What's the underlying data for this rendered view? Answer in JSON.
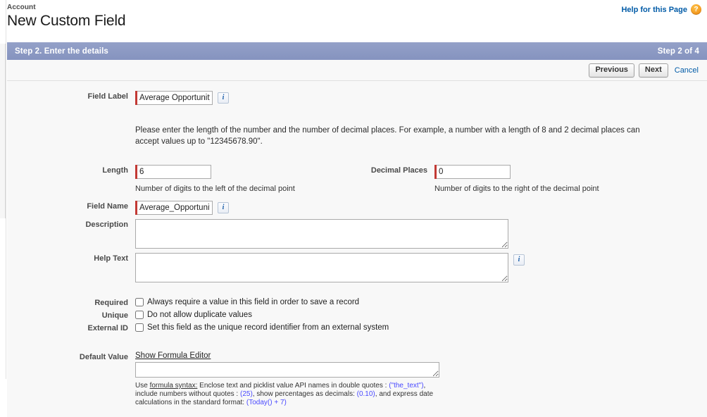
{
  "header": {
    "breadcrumb": "Account",
    "title": "New Custom Field",
    "help_link": "Help for this Page",
    "help_icon": "question-mark-icon"
  },
  "wizard": {
    "step_title": "Step 2. Enter the details",
    "step_count": "Step 2 of 4",
    "buttons": {
      "previous": "Previous",
      "next": "Next",
      "cancel": "Cancel"
    }
  },
  "form": {
    "field_label": {
      "label": "Field Label",
      "value": "Average Opportunity A",
      "info": "i",
      "required": true
    },
    "instruction": "Please enter the length of the number and the number of decimal places. For example, a number with a length of 8 and 2 decimal places can accept values up to \"12345678.90\".",
    "length": {
      "label": "Length",
      "value": "6",
      "helper": "Number of digits to the left of the decimal point",
      "required": true
    },
    "decimal_places": {
      "label": "Decimal Places",
      "value": "0",
      "helper": "Number of digits to the right of the decimal point",
      "required": true
    },
    "field_name": {
      "label": "Field Name",
      "value": "Average_Opportunity_",
      "info": "i",
      "required": true
    },
    "description": {
      "label": "Description",
      "value": ""
    },
    "help_text": {
      "label": "Help Text",
      "value": "",
      "info": "i"
    },
    "required_checkbox": {
      "label": "Required",
      "text": "Always require a value in this field in order to save a record",
      "checked": false
    },
    "unique_checkbox": {
      "label": "Unique",
      "text": "Do not allow duplicate values",
      "checked": false
    },
    "external_id_checkbox": {
      "label": "External ID",
      "text": "Set this field as the unique record identifier from an external system",
      "checked": false
    },
    "default_value": {
      "label": "Default Value",
      "formula_link": "Show Formula Editor",
      "value": "",
      "help_prefix": "Use ",
      "help_link": "formula syntax:",
      "help_part1": " Enclose text and picklist value API names in double quotes : ",
      "help_code1": "(\"the_text\")",
      "help_part2": ", include numbers without quotes : ",
      "help_code2": "(25)",
      "help_part3": ", show percentages as decimals: ",
      "help_code3": "(0.10)",
      "help_part4": ", and express date calculations in the standard format: ",
      "help_code4": "(Today() + 7)"
    }
  },
  "colors": {
    "header_bar": "#8d9bc4",
    "required_marker": "#c23934",
    "link": "#015ba7",
    "code": "#4a4aff",
    "panel_bg": "#f8f8f8"
  }
}
